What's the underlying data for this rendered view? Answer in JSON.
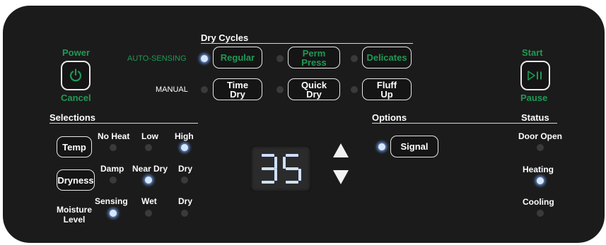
{
  "power": {
    "label": "Power",
    "cancel": "Cancel",
    "icon": "power-icon"
  },
  "start": {
    "label": "Start",
    "pause": "Pause",
    "icon": "play-pause-icon"
  },
  "dry_cycles": {
    "header": "Dry Cycles",
    "auto_sensing_label": "AUTO-SENSING",
    "manual_label": "MANUAL",
    "regular": "Regular",
    "perm_press_1": "Perm",
    "perm_press_2": "Press",
    "delicates": "Delicates",
    "time_dry_1": "Time",
    "time_dry_2": "Dry",
    "quick_dry_1": "Quick",
    "quick_dry_2": "Dry",
    "fluff_up_1": "Fluff",
    "fluff_up_2": "Up",
    "selected": "Regular"
  },
  "selections": {
    "header": "Selections",
    "temp_button": "Temp",
    "temp_options": [
      "No Heat",
      "Low",
      "High"
    ],
    "temp_selected": "High",
    "dryness_button": "Dryness",
    "dryness_options": [
      "Damp",
      "Near Dry",
      "Dry"
    ],
    "dryness_selected": "Near Dry",
    "moisture_label_1": "Moisture",
    "moisture_label_2": "Level",
    "moisture_options": [
      "Sensing",
      "Wet",
      "Dry"
    ],
    "moisture_selected": "Sensing"
  },
  "display": {
    "value": "35"
  },
  "options": {
    "header": "Options",
    "signal": "Signal",
    "signal_on": true
  },
  "status": {
    "header": "Status",
    "door_open": "Door Open",
    "heating": "Heating",
    "cooling": "Cooling",
    "active": "Heating"
  },
  "colors": {
    "panel": "#1b1b1b",
    "accent_green": "#1f9a55",
    "led_on": "#d7e6ff",
    "led_off": "#3a3a3a",
    "segment": "#cfe0ff"
  }
}
